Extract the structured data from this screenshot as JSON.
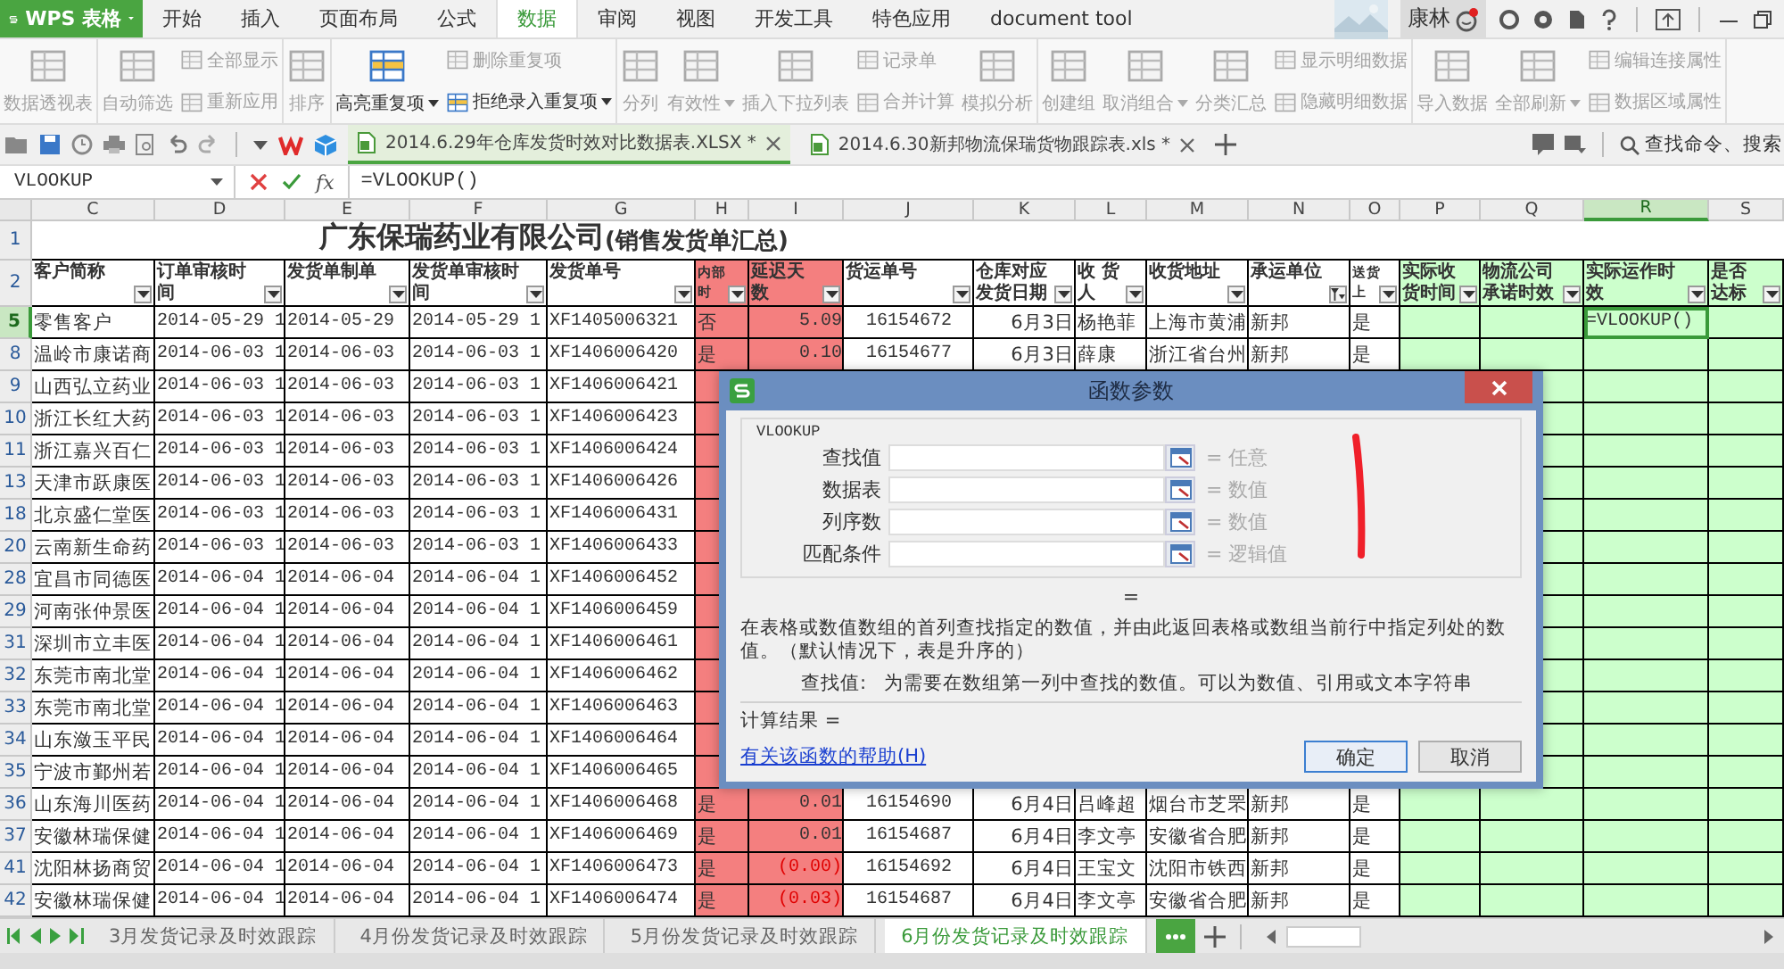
{
  "app": {
    "logo": "WPS 表格"
  },
  "menu_tabs": [
    {
      "label": "开始",
      "selected": false
    },
    {
      "label": "插入",
      "selected": false
    },
    {
      "label": "页面布局",
      "selected": false
    },
    {
      "label": "公式",
      "selected": false
    },
    {
      "label": "数据",
      "selected": true
    },
    {
      "label": "审阅",
      "selected": false
    },
    {
      "label": "视图",
      "selected": false
    },
    {
      "label": "开发工具",
      "selected": false
    },
    {
      "label": "特色应用",
      "selected": false
    },
    {
      "label": "document tool",
      "selected": false
    }
  ],
  "user": {
    "name": "康林",
    "notification": true
  },
  "ribbon": [
    {
      "columns": [
        [
          {
            "kind": "large",
            "label": "数据透视表",
            "disabled": true,
            "dropdown": false
          }
        ]
      ]
    },
    {
      "columns": [
        [
          {
            "kind": "large",
            "label": "自动筛选",
            "disabled": true,
            "dropdown": false
          }
        ],
        [
          {
            "kind": "small",
            "label": "全部显示",
            "disabled": true,
            "dropdown": false
          },
          {
            "kind": "small",
            "label": "重新应用",
            "disabled": true,
            "dropdown": false
          }
        ]
      ]
    },
    {
      "columns": [
        [
          {
            "kind": "large",
            "label": "排序",
            "disabled": true,
            "dropdown": false
          }
        ]
      ]
    },
    {
      "columns": [
        [
          {
            "kind": "large",
            "label": "高亮重复项",
            "disabled": false,
            "dropdown": true
          }
        ],
        [
          {
            "kind": "small",
            "label": "删除重复项",
            "disabled": true,
            "dropdown": false
          },
          {
            "kind": "small",
            "label": "拒绝录入重复项",
            "disabled": false,
            "dropdown": true
          }
        ]
      ]
    },
    {
      "columns": [
        [
          {
            "kind": "large",
            "label": "分列",
            "disabled": true,
            "dropdown": false
          }
        ],
        [
          {
            "kind": "large",
            "label": "有效性",
            "disabled": true,
            "dropdown": true
          }
        ],
        [
          {
            "kind": "large",
            "label": "插入下拉列表",
            "disabled": true,
            "dropdown": false
          }
        ],
        [
          {
            "kind": "small",
            "label": "记录单",
            "disabled": true,
            "dropdown": false
          },
          {
            "kind": "small",
            "label": "合并计算",
            "disabled": true,
            "dropdown": false
          }
        ],
        [
          {
            "kind": "large",
            "label": "模拟分析",
            "disabled": true,
            "dropdown": false
          }
        ]
      ]
    },
    {
      "columns": [
        [
          {
            "kind": "large",
            "label": "创建组",
            "disabled": true,
            "dropdown": false
          }
        ],
        [
          {
            "kind": "large",
            "label": "取消组合",
            "disabled": true,
            "dropdown": true
          }
        ],
        [
          {
            "kind": "large",
            "label": "分类汇总",
            "disabled": true,
            "dropdown": false
          }
        ],
        [
          {
            "kind": "small",
            "label": "显示明细数据",
            "disabled": true,
            "dropdown": false
          },
          {
            "kind": "small",
            "label": "隐藏明细数据",
            "disabled": true,
            "dropdown": false
          }
        ]
      ]
    },
    {
      "columns": [
        [
          {
            "kind": "large",
            "label": "导入数据",
            "disabled": true,
            "dropdown": false
          }
        ],
        [
          {
            "kind": "large",
            "label": "全部刷新",
            "disabled": true,
            "dropdown": true
          }
        ],
        [
          {
            "kind": "small",
            "label": "编辑连接属性",
            "disabled": true,
            "dropdown": false
          },
          {
            "kind": "small",
            "label": "数据区域属性",
            "disabled": true,
            "dropdown": false
          }
        ]
      ]
    }
  ],
  "doc_tabs": [
    {
      "title": "2014.6.29年仓库发货时效对比数据表.XLSX *",
      "selected": true
    },
    {
      "title": "2014.6.30新邦物流保瑞货物跟踪表.xls *",
      "selected": false
    }
  ],
  "search": {
    "placeholder": "查找命令、搜索"
  },
  "formula_bar": {
    "name_box": "VLOOKUP",
    "fx": "fx",
    "formula": "=VLOOKUP()"
  },
  "sheet": {
    "title": "广东保瑞药业有限公司",
    "subtitle": "(销售发货单汇总)",
    "title_row": "1",
    "header_row": "2",
    "columns": [
      {
        "letter": "C",
        "header": "客户简称",
        "selected": false,
        "filtered": false
      },
      {
        "letter": "D",
        "header": "订单审核时间",
        "selected": false,
        "filtered": false
      },
      {
        "letter": "E",
        "header": "发货单制单",
        "selected": false,
        "filtered": false
      },
      {
        "letter": "F",
        "header": "发货单审核时间",
        "selected": false,
        "filtered": false
      },
      {
        "letter": "G",
        "header": "发货单号",
        "selected": false,
        "filtered": false
      },
      {
        "letter": "H",
        "header": "内部时",
        "selected": false,
        "filtered": false,
        "color": "#f47f7f"
      },
      {
        "letter": "I",
        "header": "延迟天数",
        "selected": false,
        "filtered": false,
        "color": "#f47f7f"
      },
      {
        "letter": "J",
        "header": "货运单号",
        "selected": false,
        "filtered": false
      },
      {
        "letter": "K",
        "header": "仓库对应发货日期",
        "selected": false,
        "filtered": false
      },
      {
        "letter": "L",
        "header": "收 货人",
        "selected": false,
        "filtered": false
      },
      {
        "letter": "M",
        "header": "收货地址",
        "selected": false,
        "filtered": false
      },
      {
        "letter": "N",
        "header": "承运单位",
        "selected": false,
        "filtered": true
      },
      {
        "letter": "O",
        "header": "送货上",
        "selected": false,
        "filtered": false
      },
      {
        "letter": "P",
        "header": "实际收货时间",
        "selected": false,
        "filtered": false,
        "color": "#ccffcc"
      },
      {
        "letter": "Q",
        "header": "物流公司承诺时效",
        "selected": false,
        "filtered": false,
        "color": "#ccffcc"
      },
      {
        "letter": "R",
        "header": "实际运作时效",
        "selected": true,
        "filtered": false,
        "color": "#ccffcc"
      },
      {
        "letter": "S",
        "header": "是否达标",
        "selected": false,
        "filtered": false,
        "color": "#ccffcc"
      }
    ],
    "rows": [
      {
        "num": "5",
        "selected": true,
        "negative": false,
        "cells": {
          "C": "零售客户",
          "D": "2014-05-29 1",
          "E": "2014-05-29",
          "F": "2014-05-29 1",
          "G": "XF1405006321",
          "H": "否",
          "I": "5.09",
          "J": "16154672",
          "K": "6月3日",
          "L": "杨艳菲",
          "M": "上海市黄浦",
          "N": "新邦",
          "O": "是",
          "R": "=VLOOKUP()"
        }
      },
      {
        "num": "8",
        "selected": false,
        "negative": false,
        "cells": {
          "C": "温岭市康诺商",
          "D": "2014-06-03 1",
          "E": "2014-06-03",
          "F": "2014-06-03 1",
          "G": "XF1406006420",
          "H": "是",
          "I": "0.10",
          "J": "16154677",
          "K": "6月3日",
          "L": "薛康",
          "M": "浙江省台州",
          "N": "新邦",
          "O": "是"
        }
      },
      {
        "num": "9",
        "selected": false,
        "cells": {
          "C": "山西弘立药业",
          "D": "2014-06-03 1",
          "E": "2014-06-03",
          "F": "2014-06-03 1",
          "G": "XF1406006421"
        }
      },
      {
        "num": "10",
        "selected": false,
        "cells": {
          "C": "浙江长红大药",
          "D": "2014-06-03 1",
          "E": "2014-06-03",
          "F": "2014-06-03 1",
          "G": "XF1406006423"
        }
      },
      {
        "num": "11",
        "selected": false,
        "cells": {
          "C": "浙江嘉兴百仁",
          "D": "2014-06-03 1",
          "E": "2014-06-03",
          "F": "2014-06-03 1",
          "G": "XF1406006424"
        }
      },
      {
        "num": "13",
        "selected": false,
        "cells": {
          "C": "天津市跃康医",
          "D": "2014-06-03 1",
          "E": "2014-06-03",
          "F": "2014-06-03 1",
          "G": "XF1406006426"
        }
      },
      {
        "num": "18",
        "selected": false,
        "cells": {
          "C": "北京盛仁堂医",
          "D": "2014-06-03 1",
          "E": "2014-06-03",
          "F": "2014-06-03 1",
          "G": "XF1406006431"
        }
      },
      {
        "num": "20",
        "selected": false,
        "cells": {
          "C": "云南新生命药",
          "D": "2014-06-03 1",
          "E": "2014-06-03",
          "F": "2014-06-03 1",
          "G": "XF1406006433"
        }
      },
      {
        "num": "28",
        "selected": false,
        "cells": {
          "C": "宜昌市同德医",
          "D": "2014-06-04 1",
          "E": "2014-06-04",
          "F": "2014-06-04 1",
          "G": "XF1406006452"
        }
      },
      {
        "num": "29",
        "selected": false,
        "cells": {
          "C": "河南张仲景医",
          "D": "2014-06-04 1",
          "E": "2014-06-04",
          "F": "2014-06-04 1",
          "G": "XF1406006459"
        }
      },
      {
        "num": "31",
        "selected": false,
        "cells": {
          "C": "深圳市立丰医",
          "D": "2014-06-04 1",
          "E": "2014-06-04",
          "F": "2014-06-04 1",
          "G": "XF1406006461"
        }
      },
      {
        "num": "32",
        "selected": false,
        "cells": {
          "C": "东莞市南北堂",
          "D": "2014-06-04 1",
          "E": "2014-06-04",
          "F": "2014-06-04 1",
          "G": "XF1406006462"
        }
      },
      {
        "num": "33",
        "selected": false,
        "cells": {
          "C": "东莞市南北堂",
          "D": "2014-06-04 1",
          "E": "2014-06-04",
          "F": "2014-06-04 1",
          "G": "XF1406006463"
        }
      },
      {
        "num": "34",
        "selected": false,
        "cells": {
          "C": "山东潋玉平民",
          "D": "2014-06-04 1",
          "E": "2014-06-04",
          "F": "2014-06-04 1",
          "G": "XF1406006464"
        }
      },
      {
        "num": "35",
        "selected": false,
        "cells": {
          "C": "宁波市鄞州若",
          "D": "2014-06-04 1",
          "E": "2014-06-04",
          "F": "2014-06-04 1",
          "G": "XF1406006465"
        }
      },
      {
        "num": "36",
        "selected": false,
        "negative": false,
        "cells": {
          "C": "山东海川医药",
          "D": "2014-06-04 1",
          "E": "2014-06-04",
          "F": "2014-06-04 1",
          "G": "XF1406006468",
          "H": "是",
          "I": "0.01",
          "J": "16154690",
          "K": "6月4日",
          "L": "吕峰超",
          "M": "烟台市芝罘",
          "N": "新邦",
          "O": "是"
        }
      },
      {
        "num": "37",
        "selected": false,
        "negative": false,
        "cells": {
          "C": "安徽林瑞保健",
          "D": "2014-06-04 1",
          "E": "2014-06-04",
          "F": "2014-06-04 1",
          "G": "XF1406006469",
          "H": "是",
          "I": "0.01",
          "J": "16154687",
          "K": "6月4日",
          "L": "李文亭",
          "M": "安徽省合肥",
          "N": "新邦",
          "O": "是"
        }
      },
      {
        "num": "41",
        "selected": false,
        "negative": true,
        "cells": {
          "C": "沈阳林扬商贸",
          "D": "2014-06-04 1",
          "E": "2014-06-04",
          "F": "2014-06-04 1",
          "G": "XF1406006473",
          "H": "是",
          "I": "(0.00)",
          "J": "16154692",
          "K": "6月4日",
          "L": "王宝文",
          "M": "沈阳市铁西",
          "N": "新邦",
          "O": "是"
        }
      },
      {
        "num": "42",
        "selected": false,
        "negative": true,
        "cells": {
          "C": "安徽林瑞保健",
          "D": "2014-06-04 1",
          "E": "2014-06-04",
          "F": "2014-06-04 1",
          "G": "XF1406006474",
          "H": "是",
          "I": "(0.03)",
          "J": "16154687",
          "K": "6月4日",
          "L": "李文亭",
          "M": "安徽省合肥",
          "N": "新邦",
          "O": "是"
        }
      }
    ]
  },
  "dialog": {
    "title": "函数参数",
    "function": "VLOOKUP",
    "params": [
      {
        "label": "查找值",
        "type": "= 任意"
      },
      {
        "label": "数据表",
        "type": "= 数值"
      },
      {
        "label": "列序数",
        "type": "= 数值"
      },
      {
        "label": "匹配条件",
        "type": "= 逻辑值"
      }
    ],
    "equals": "=",
    "description": "在表格或数值数组的首列查找指定的数值，并由此返回表格或数组当前行中指定列处的数值。（默认情况下，表是升序的）",
    "param_help_label": "查找值:",
    "param_help": "为需要在数组第一列中查找的数值。可以为数值、引用或文本字符串",
    "result_label": "计算结果 =",
    "help_link": "有关该函数的帮助(H)",
    "buttons": [
      {
        "label": "确定",
        "default": true
      },
      {
        "label": "取消",
        "default": false
      }
    ]
  },
  "sheet_tabs": [
    {
      "label": "3月发货记录及时效跟踪",
      "selected": false
    },
    {
      "label": "4月份发货记录及时效跟踪",
      "selected": false
    },
    {
      "label": "5月份发货记录及时效跟踪",
      "selected": false
    },
    {
      "label": "6月份发货记录及时效跟踪",
      "selected": true
    }
  ]
}
